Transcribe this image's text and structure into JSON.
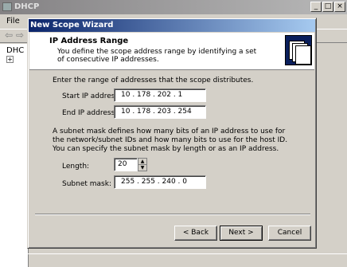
{
  "background_window": {
    "title": "DHCP",
    "menu_file": "File",
    "tree_item": "DHC"
  },
  "wizard": {
    "title": "New Scope Wizard",
    "header_title": "IP Address Range",
    "header_description": "You define the scope address range by identifying a set of consecutive IP addresses.",
    "range_intro": "Enter the range of addresses that the scope distributes.",
    "start_ip_label": "Start IP address:",
    "start_ip_value": "10 . 178 . 202 . 1",
    "end_ip_label": "End IP address:",
    "end_ip_value": "10 . 178 . 203 . 254",
    "subnet_description": "A subnet mask defines how many bits of an IP address to use for the network/subnet IDs and how many bits to use for the host ID. You can specify the subnet mask by length or as an IP address.",
    "length_label": "Length:",
    "length_value": "20",
    "subnet_label": "Subnet mask:",
    "subnet_value": "255 . 255 . 240 . 0",
    "back_button": "< Back",
    "next_button": "Next >",
    "cancel_button": "Cancel"
  }
}
